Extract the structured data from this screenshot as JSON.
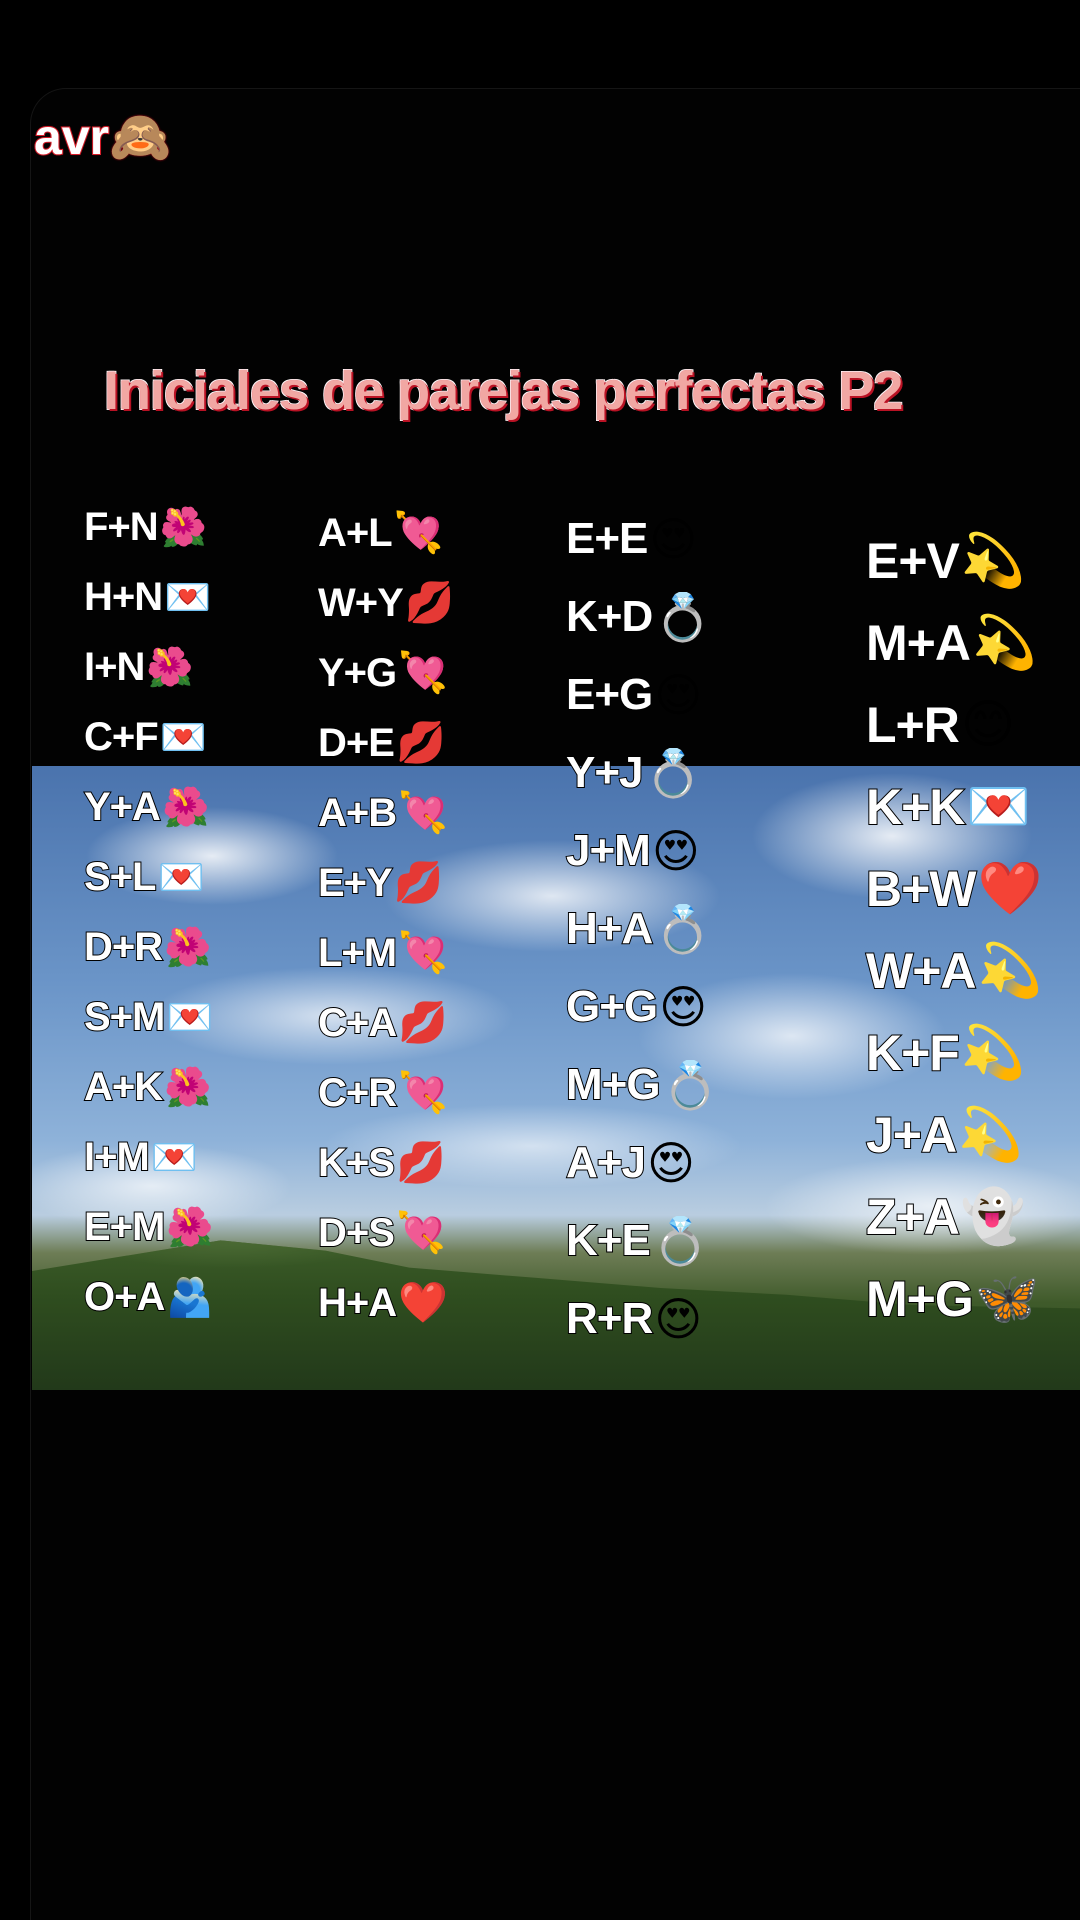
{
  "caption": {
    "text": "avr",
    "emoji": "🙈"
  },
  "title": "Iniciales de parejas perfectas P2",
  "columns": [
    {
      "pairs": [
        {
          "initials": "F+N",
          "emoji": "🌺"
        },
        {
          "initials": "H+N",
          "emoji": "💌"
        },
        {
          "initials": "I+N",
          "emoji": "🌺"
        },
        {
          "initials": "C+F",
          "emoji": "💌"
        },
        {
          "initials": "Y+A",
          "emoji": "🌺"
        },
        {
          "initials": "S+L",
          "emoji": "💌"
        },
        {
          "initials": "D+R",
          "emoji": "🌺"
        },
        {
          "initials": "S+M",
          "emoji": "💌"
        },
        {
          "initials": "A+K",
          "emoji": "🌺"
        },
        {
          "initials": "I+M",
          "emoji": "💌"
        },
        {
          "initials": "E+M",
          "emoji": "🌺"
        },
        {
          "initials": "O+A",
          "emoji": "🫂"
        }
      ]
    },
    {
      "pairs": [
        {
          "initials": "A+L",
          "emoji": "💘"
        },
        {
          "initials": "W+Y",
          "emoji": "💋"
        },
        {
          "initials": "Y+G",
          "emoji": "💘"
        },
        {
          "initials": "D+E",
          "emoji": "💋"
        },
        {
          "initials": "A+B",
          "emoji": "💘"
        },
        {
          "initials": "E+Y",
          "emoji": "💋"
        },
        {
          "initials": "L+M",
          "emoji": "💘"
        },
        {
          "initials": "C+A",
          "emoji": "💋"
        },
        {
          "initials": "C+R",
          "emoji": "💘"
        },
        {
          "initials": "K+S",
          "emoji": "💋"
        },
        {
          "initials": "D+S",
          "emoji": "💘"
        },
        {
          "initials": "H+A",
          "emoji": "❤️"
        }
      ]
    },
    {
      "pairs": [
        {
          "initials": "E+E",
          "emoji": "😍"
        },
        {
          "initials": "K+D",
          "emoji": "💍"
        },
        {
          "initials": "E+G",
          "emoji": "😍"
        },
        {
          "initials": "Y+J",
          "emoji": "💍"
        },
        {
          "initials": "J+M",
          "emoji": "😍"
        },
        {
          "initials": "H+A",
          "emoji": "💍"
        },
        {
          "initials": "G+G",
          "emoji": "😍"
        },
        {
          "initials": "M+G",
          "emoji": "💍"
        },
        {
          "initials": "A+J",
          "emoji": "😍"
        },
        {
          "initials": "K+E",
          "emoji": "💍"
        },
        {
          "initials": "R+R",
          "emoji": "😍"
        }
      ]
    },
    {
      "pairs": [
        {
          "initials": "E+V",
          "emoji": "💫"
        },
        {
          "initials": "M+A",
          "emoji": "💫"
        },
        {
          "initials": "L+R",
          "emoji": "😊"
        },
        {
          "initials": "K+K",
          "emoji": "💌"
        },
        {
          "initials": "B+W",
          "emoji": "❤️"
        },
        {
          "initials": "W+A",
          "emoji": "💫"
        },
        {
          "initials": "K+F",
          "emoji": "💫"
        },
        {
          "initials": "J+A",
          "emoji": "💫"
        },
        {
          "initials": "Z+A",
          "emoji": "👻"
        },
        {
          "initials": "M+G",
          "emoji": "🦋"
        }
      ]
    }
  ]
}
